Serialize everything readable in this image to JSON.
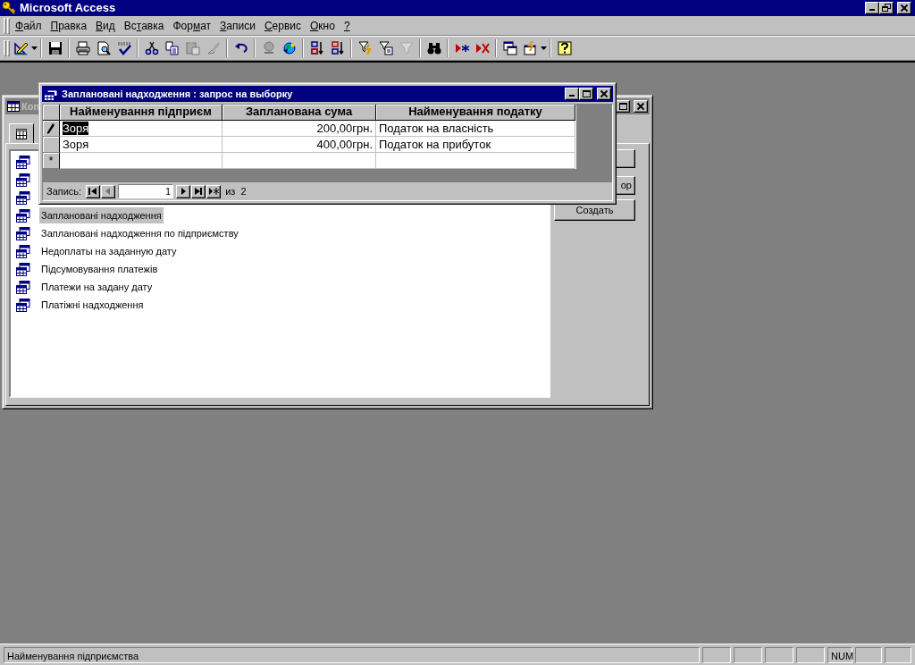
{
  "app": {
    "title": "Microsoft Access"
  },
  "menu": [
    {
      "key": "Ф",
      "post": "айл"
    },
    {
      "key": "П",
      "post": "равка"
    },
    {
      "key": "В",
      "post": "ид"
    },
    {
      "pre": "Вс",
      "key": "т",
      "post": "авка"
    },
    {
      "pre": "Фор",
      "key": "м",
      "post": "ат"
    },
    {
      "key": "З",
      "post": "аписи"
    },
    {
      "key": "С",
      "post": "ервис"
    },
    {
      "key": "О",
      "post": "кно"
    },
    {
      "key": "?"
    }
  ],
  "toolbar_groups": [
    [
      {
        "disabled": false
      }
    ],
    [
      {
        "disabled": false
      }
    ],
    [
      {
        "disabled": false
      },
      {
        "disabled": false
      },
      {
        "disabled": false
      }
    ],
    [
      {
        "disabled": false
      },
      {
        "disabled": false
      },
      {
        "disabled": true
      },
      {
        "disabled": true
      }
    ],
    [
      {
        "disabled": false
      }
    ],
    [
      {
        "disabled": true
      },
      {
        "disabled": false
      }
    ],
    [
      {
        "disabled": false
      },
      {
        "disabled": false
      }
    ],
    [
      {
        "disabled": false
      },
      {
        "disabled": false
      },
      {
        "disabled": true
      }
    ],
    [
      {
        "disabled": false
      }
    ],
    [
      {
        "disabled": false
      },
      {
        "disabled": false
      }
    ],
    [
      {
        "disabled": false
      },
      {
        "disabled": false
      }
    ],
    [
      {
        "disabled": false
      }
    ]
  ],
  "database_window": {
    "title": "Коп",
    "items": [
      {
        "kind": "query"
      },
      {
        "kind": "query"
      },
      {
        "kind": "query"
      },
      {
        "kind": "query",
        "label": "Заплановані надходження",
        "selected": true
      },
      {
        "kind": "query",
        "label": "Заплановані надходження по підприємству",
        "selected": false
      },
      {
        "kind": "query",
        "label": "Недоплаты на заданную дату",
        "selected": false
      },
      {
        "kind": "query",
        "label": "Підсумовування платежів",
        "selected": false
      },
      {
        "kind": "query",
        "label": "Платежи на задану дату",
        "selected": false
      },
      {
        "kind": "query",
        "label": "Платіжні надходження",
        "selected": false
      }
    ],
    "buttons": [
      {
        "kind": "covered"
      },
      {
        "kind": "labeled",
        "label": "ор"
      },
      {
        "kind": "labeled",
        "label": "Создать"
      }
    ]
  },
  "query_window": {
    "title": "Заплановані надходження : запрос на выборку",
    "columns": [
      "Найменування підприєм",
      "Запланована сума",
      "Найменування податку"
    ],
    "rows": [
      {
        "kind": "record",
        "editing": true,
        "cells": [
          {
            "text": "Зоря",
            "selected": true
          },
          {
            "text": "200,00грн.",
            "selected": false
          },
          {
            "text": "Податок на власність",
            "selected": false
          }
        ]
      },
      {
        "kind": "record",
        "editing": false,
        "cells": [
          {
            "text": "Зоря",
            "selected": false
          },
          {
            "text": "400,00грн.",
            "selected": false
          },
          {
            "text": "Податок на прибуток",
            "selected": false
          }
        ]
      },
      {
        "kind": "new",
        "marker": "*"
      }
    ],
    "navigator": {
      "label": "Запись:",
      "buttons": [
        {
          "disabled": false
        },
        {
          "disabled": true
        }
      ],
      "record": "1",
      "buttons_after": [
        {
          "disabled": false
        },
        {
          "disabled": false
        },
        {
          "disabled": false
        }
      ],
      "total": "из  2"
    }
  },
  "status_bar": {
    "text": "Найменування підприємства",
    "indicator": "NUM"
  }
}
